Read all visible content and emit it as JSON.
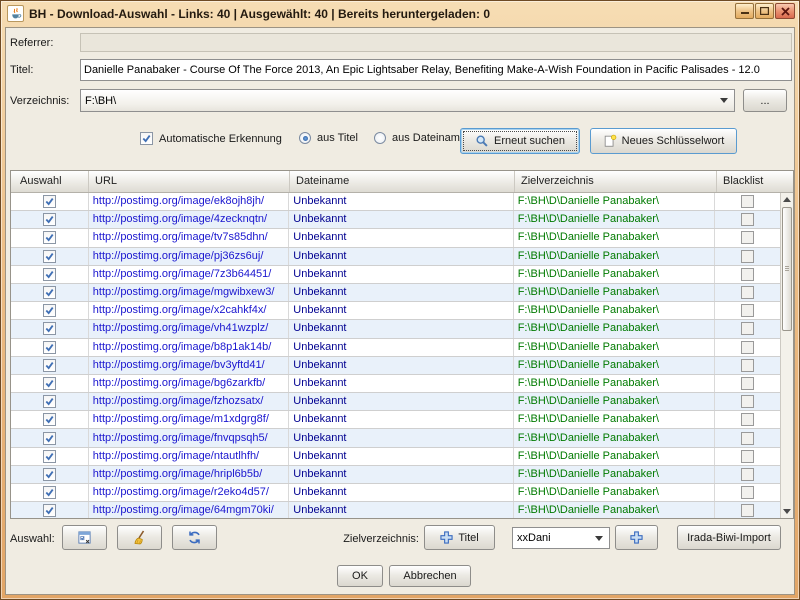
{
  "window": {
    "title": "BH - Download-Auswahl - Links: 40 | Ausgewählt: 40 | Bereits heruntergeladen: 0"
  },
  "form": {
    "referrer_label": "Referrer:",
    "referrer_value": "",
    "titel_label": "Titel:",
    "titel_value": "Danielle Panabaker - Course Of The Force 2013, An Epic Lightsaber Relay, Benefiting Make-A-Wish Foundation in Pacific Palisades - 12.0",
    "verzeichnis_label": "Verzeichnis:",
    "verzeichnis_value": "F:\\BH\\",
    "browse_label": "...",
    "auto_detect_label": "Automatische Erkennung",
    "auto_detect_checked": true,
    "radio_from_title_label": "aus Titel",
    "radio_from_title_selected": true,
    "radio_from_filename_label": "aus Dateiname",
    "radio_from_filename_selected": false,
    "search_again_label": "Erneut suchen",
    "new_keyword_label": "Neues Schlüsselwort"
  },
  "table": {
    "columns": [
      "Auswahl",
      "URL",
      "Dateiname",
      "Zielverzeichnis",
      "Blacklist"
    ],
    "rows": [
      {
        "auswahl": true,
        "url": "http://postimg.org/image/ek8ojh8jh/",
        "dateiname": "Unbekannt",
        "zielverzeichnis": "F:\\BH\\D\\Danielle Panabaker\\",
        "blacklist": false
      },
      {
        "auswahl": true,
        "url": "http://postimg.org/image/4zecknqtn/",
        "dateiname": "Unbekannt",
        "zielverzeichnis": "F:\\BH\\D\\Danielle Panabaker\\",
        "blacklist": false
      },
      {
        "auswahl": true,
        "url": "http://postimg.org/image/tv7s85dhn/",
        "dateiname": "Unbekannt",
        "zielverzeichnis": "F:\\BH\\D\\Danielle Panabaker\\",
        "blacklist": false
      },
      {
        "auswahl": true,
        "url": "http://postimg.org/image/pj36zs6uj/",
        "dateiname": "Unbekannt",
        "zielverzeichnis": "F:\\BH\\D\\Danielle Panabaker\\",
        "blacklist": false
      },
      {
        "auswahl": true,
        "url": "http://postimg.org/image/7z3b64451/",
        "dateiname": "Unbekannt",
        "zielverzeichnis": "F:\\BH\\D\\Danielle Panabaker\\",
        "blacklist": false
      },
      {
        "auswahl": true,
        "url": "http://postimg.org/image/mgwibxew3/",
        "dateiname": "Unbekannt",
        "zielverzeichnis": "F:\\BH\\D\\Danielle Panabaker\\",
        "blacklist": false
      },
      {
        "auswahl": true,
        "url": "http://postimg.org/image/x2cahkf4x/",
        "dateiname": "Unbekannt",
        "zielverzeichnis": "F:\\BH\\D\\Danielle Panabaker\\",
        "blacklist": false
      },
      {
        "auswahl": true,
        "url": "http://postimg.org/image/vh41wzplz/",
        "dateiname": "Unbekannt",
        "zielverzeichnis": "F:\\BH\\D\\Danielle Panabaker\\",
        "blacklist": false
      },
      {
        "auswahl": true,
        "url": "http://postimg.org/image/b8p1ak14b/",
        "dateiname": "Unbekannt",
        "zielverzeichnis": "F:\\BH\\D\\Danielle Panabaker\\",
        "blacklist": false
      },
      {
        "auswahl": true,
        "url": "http://postimg.org/image/bv3yftd41/",
        "dateiname": "Unbekannt",
        "zielverzeichnis": "F:\\BH\\D\\Danielle Panabaker\\",
        "blacklist": false
      },
      {
        "auswahl": true,
        "url": "http://postimg.org/image/bg6zarkfb/",
        "dateiname": "Unbekannt",
        "zielverzeichnis": "F:\\BH\\D\\Danielle Panabaker\\",
        "blacklist": false
      },
      {
        "auswahl": true,
        "url": "http://postimg.org/image/fzhozsatx/",
        "dateiname": "Unbekannt",
        "zielverzeichnis": "F:\\BH\\D\\Danielle Panabaker\\",
        "blacklist": false
      },
      {
        "auswahl": true,
        "url": "http://postimg.org/image/m1xdgrg8f/",
        "dateiname": "Unbekannt",
        "zielverzeichnis": "F:\\BH\\D\\Danielle Panabaker\\",
        "blacklist": false
      },
      {
        "auswahl": true,
        "url": "http://postimg.org/image/fnvqpsqh5/",
        "dateiname": "Unbekannt",
        "zielverzeichnis": "F:\\BH\\D\\Danielle Panabaker\\",
        "blacklist": false
      },
      {
        "auswahl": true,
        "url": "http://postimg.org/image/ntautlhfh/",
        "dateiname": "Unbekannt",
        "zielverzeichnis": "F:\\BH\\D\\Danielle Panabaker\\",
        "blacklist": false
      },
      {
        "auswahl": true,
        "url": "http://postimg.org/image/hripl6b5b/",
        "dateiname": "Unbekannt",
        "zielverzeichnis": "F:\\BH\\D\\Danielle Panabaker\\",
        "blacklist": false
      },
      {
        "auswahl": true,
        "url": "http://postimg.org/image/r2eko4d57/",
        "dateiname": "Unbekannt",
        "zielverzeichnis": "F:\\BH\\D\\Danielle Panabaker\\",
        "blacklist": false
      },
      {
        "auswahl": true,
        "url": "http://postimg.org/image/64mgm70ki/",
        "dateiname": "Unbekannt",
        "zielverzeichnis": "F:\\BH\\D\\Danielle Panabaker\\",
        "blacklist": false
      }
    ]
  },
  "footer": {
    "selection_label": "Auswahl:",
    "target_dir_label": "Zielverzeichnis:",
    "add_title_label": "Titel",
    "keyword_value": "xxDani",
    "irada_import_label": "Irada-Biwi-Import",
    "ok_label": "OK",
    "cancel_label": "Abbrechen"
  },
  "icons": {
    "app": "java-coffee-icon",
    "search": "magnifier-icon",
    "new_keyword": "new-page-icon",
    "selection": "selection-list-icon",
    "clean": "broom-icon",
    "refresh": "refresh-icon",
    "add": "plus-icon",
    "dropdown": "chevron-down-icon"
  },
  "colors": {
    "titlebar": "#eec089",
    "dialog_bg": "#f0ece2",
    "accent_border": "#5a9bd0",
    "url_text": "#1a16cf",
    "dateiname_text": "#000090",
    "zielverzeichnis_text": "#007a00",
    "row_alt": "#e9f1fa",
    "check_blue": "#3f6fb5"
  }
}
